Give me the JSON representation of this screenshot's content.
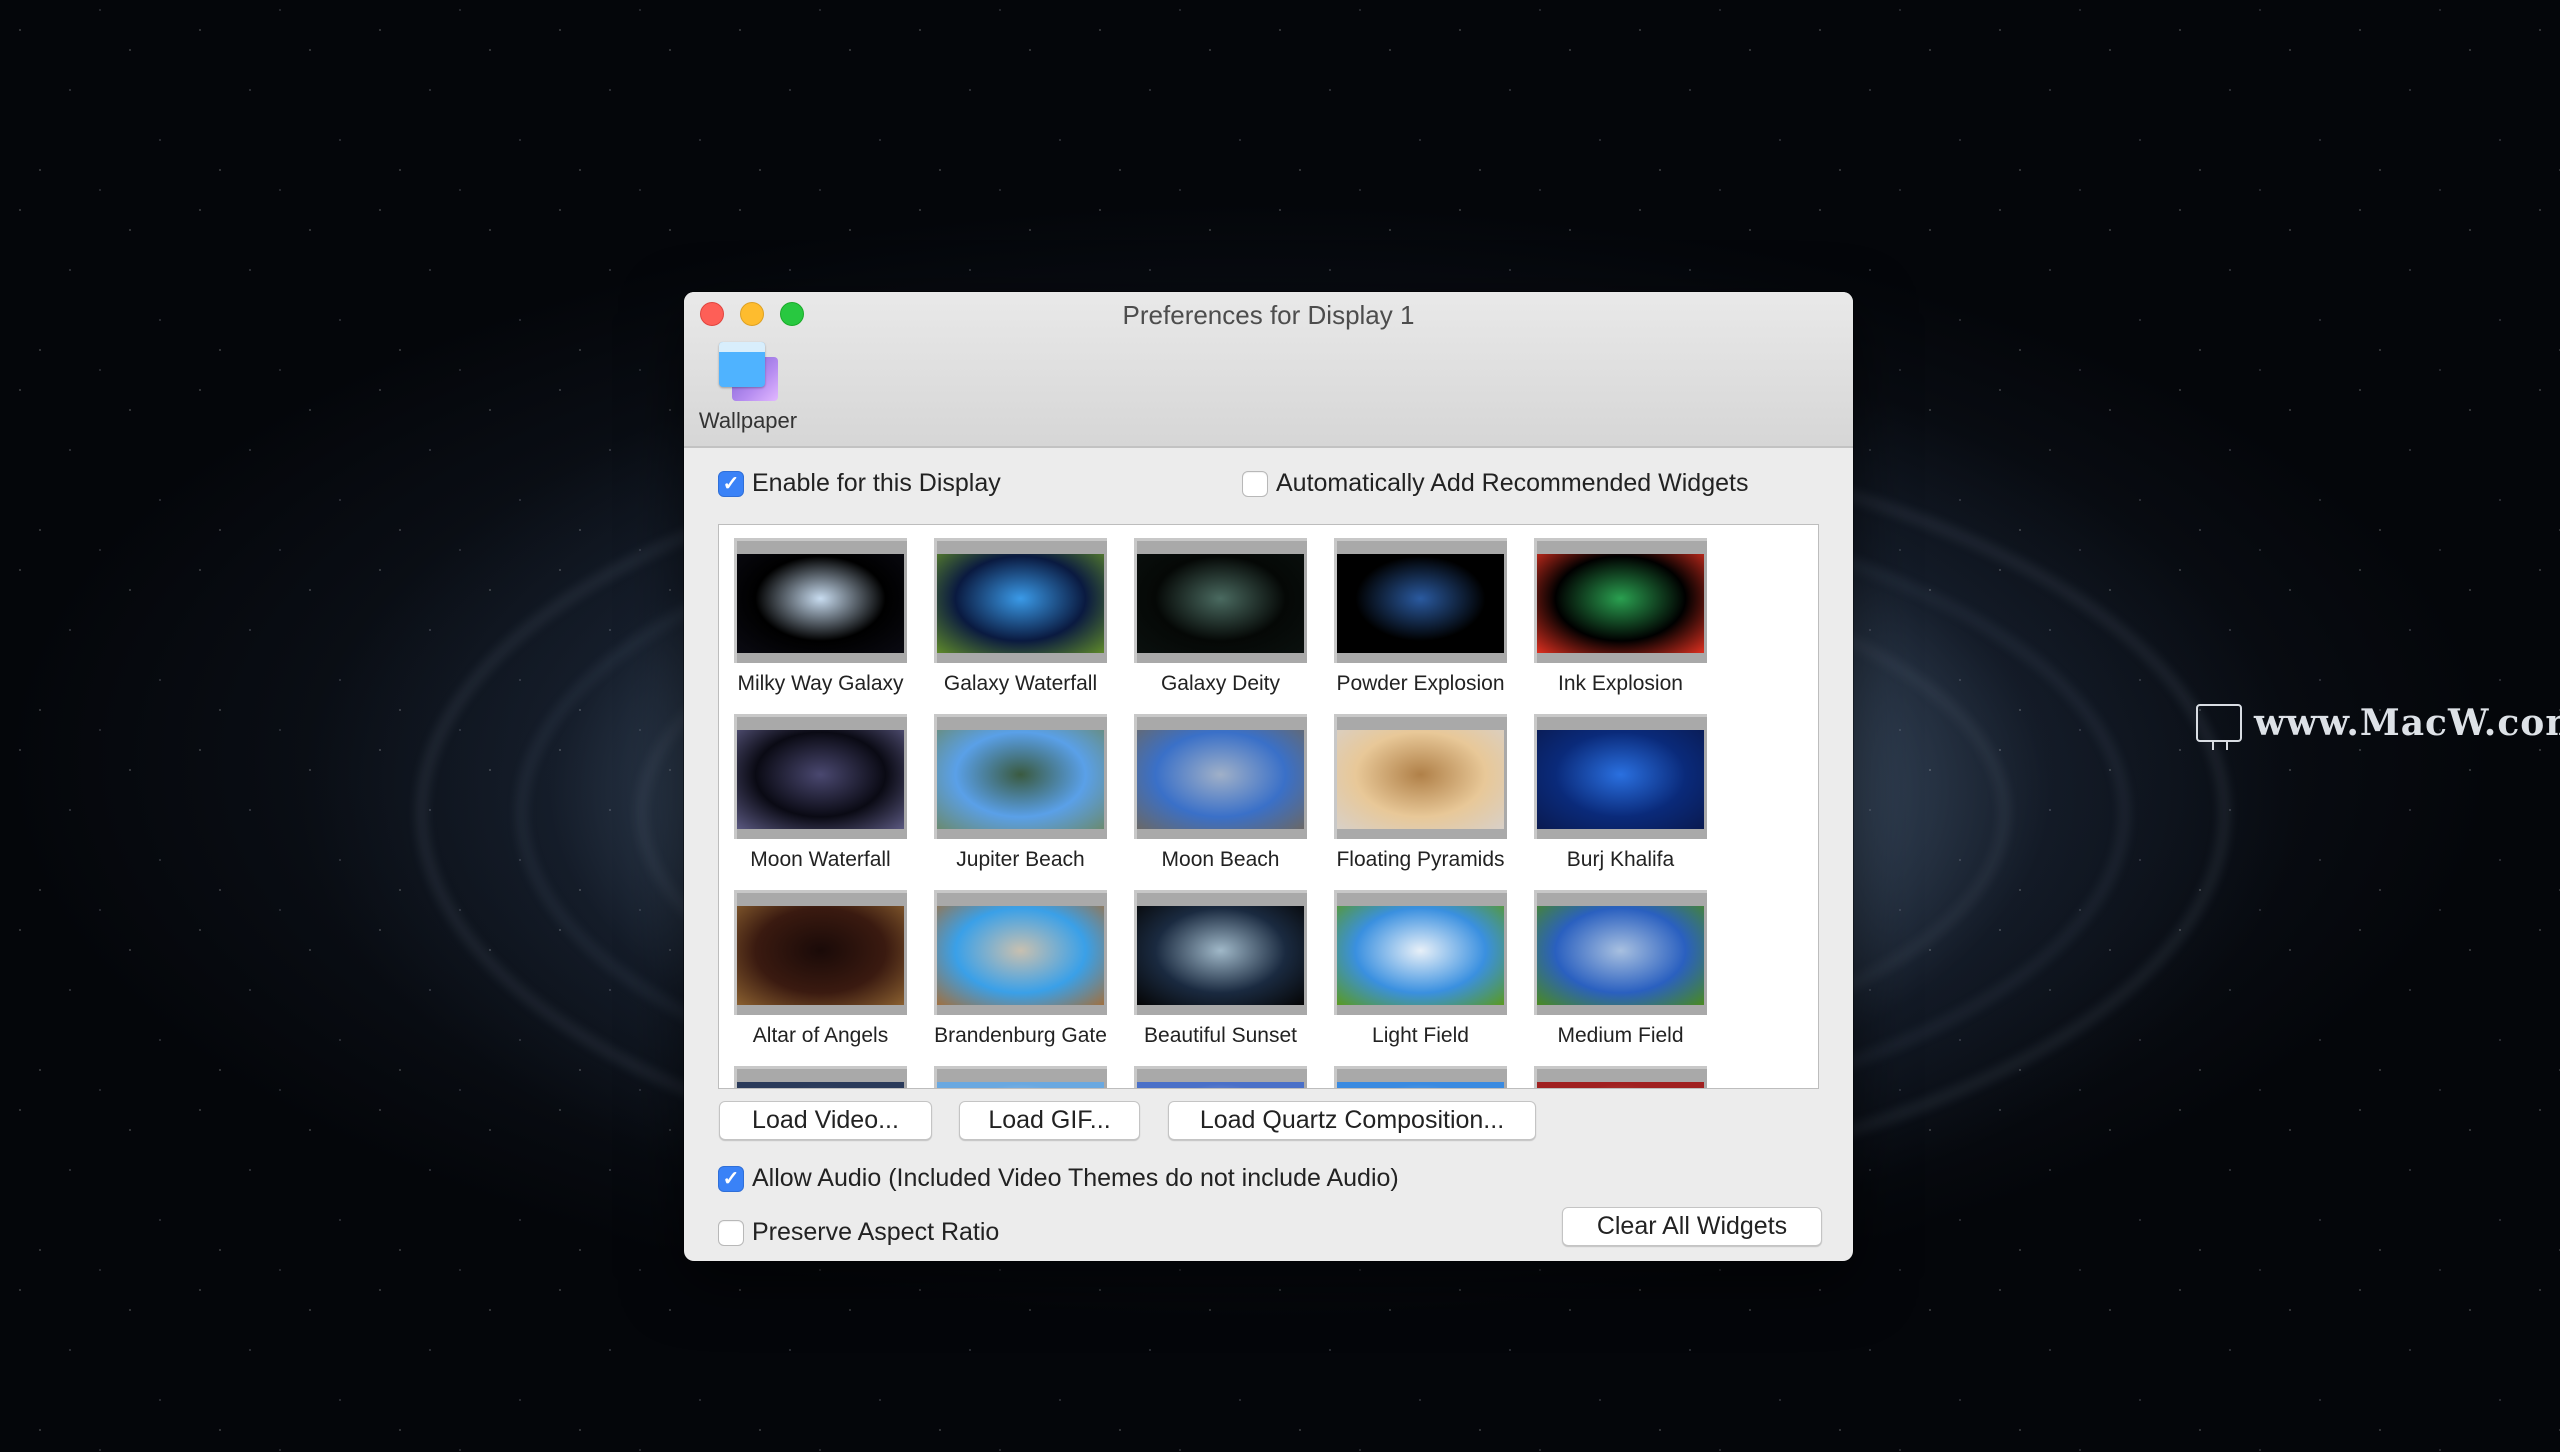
{
  "desktop": {
    "watermark": "www.MacW.com"
  },
  "window": {
    "title": "Preferences for Display 1",
    "toolbar": {
      "items": [
        {
          "label": "Wallpaper",
          "icon": "wallpaper-icon"
        }
      ]
    },
    "options": {
      "enable_display": {
        "label": "Enable for this Display",
        "checked": true
      },
      "auto_add_widgets": {
        "label": "Automatically Add Recommended Widgets",
        "checked": false
      },
      "allow_audio": {
        "label": "Allow Audio (Included Video Themes do not include Audio)",
        "checked": true
      },
      "preserve_aspect": {
        "label": "Preserve Aspect Ratio",
        "checked": false
      }
    },
    "buttons": {
      "load_video": "Load Video...",
      "load_gif": "Load GIF...",
      "load_quartz": "Load Quartz Composition...",
      "clear_widgets": "Clear All Widgets"
    },
    "themes": [
      {
        "name": "Milky Way Galaxy",
        "colors": [
          "#000000",
          "#c8dcf0",
          "#0a0a12"
        ]
      },
      {
        "name": "Galaxy Waterfall",
        "colors": [
          "#0a1a40",
          "#3a9ae8",
          "#5f8a2a"
        ]
      },
      {
        "name": "Galaxy Deity",
        "colors": [
          "#050806",
          "#4a6a60",
          "#0a100e"
        ]
      },
      {
        "name": "Powder Explosion",
        "colors": [
          "#000000",
          "#2a5aa0",
          "#000000"
        ]
      },
      {
        "name": "Ink Explosion",
        "colors": [
          "#000000",
          "#2aa050",
          "#e03020"
        ]
      },
      {
        "name": "Moon Waterfall",
        "colors": [
          "#0a0a14",
          "#4a4870",
          "#5a5880"
        ]
      },
      {
        "name": "Jupiter Beach",
        "colors": [
          "#5aa0e8",
          "#3a5a40",
          "#6a8a70"
        ]
      },
      {
        "name": "Moon Beach",
        "colors": [
          "#3a70c8",
          "#a0b0c8",
          "#6a6866"
        ]
      },
      {
        "name": "Floating Pyramids",
        "colors": [
          "#e8c898",
          "#b08048",
          "#d8d0c8"
        ]
      },
      {
        "name": "Burj Khalifa",
        "colors": [
          "#0a2a7a",
          "#2a70e0",
          "#0a1a50"
        ]
      },
      {
        "name": "Altar of Angels",
        "colors": [
          "#3a1a10",
          "#1a0a08",
          "#8a6030"
        ]
      },
      {
        "name": "Brandenburg Gate",
        "colors": [
          "#3aa0e8",
          "#c8c0b0",
          "#a07040"
        ]
      },
      {
        "name": "Beautiful Sunset",
        "colors": [
          "#1a2a40",
          "#a0b8c8",
          "#050505"
        ]
      },
      {
        "name": "Light Field",
        "colors": [
          "#3a90e0",
          "#e8f0f8",
          "#5a9a20"
        ]
      },
      {
        "name": "Medium Field",
        "colors": [
          "#2a60c0",
          "#a8c0e0",
          "#4a8a20"
        ]
      },
      {
        "name": "",
        "colors": [
          "#2a3a5a",
          "#4a5a7a",
          "#2a3a5a"
        ]
      },
      {
        "name": "",
        "colors": [
          "#6aa8e0",
          "#c8e0f8",
          "#6aa8e0"
        ]
      },
      {
        "name": "",
        "colors": [
          "#4a70c8",
          "#c8d0e8",
          "#4a70c8"
        ]
      },
      {
        "name": "",
        "colors": [
          "#3a8ae0",
          "#a8d0f0",
          "#3a8ae0"
        ]
      },
      {
        "name": "",
        "colors": [
          "#a02020",
          "#c89070",
          "#a02020"
        ]
      }
    ]
  }
}
